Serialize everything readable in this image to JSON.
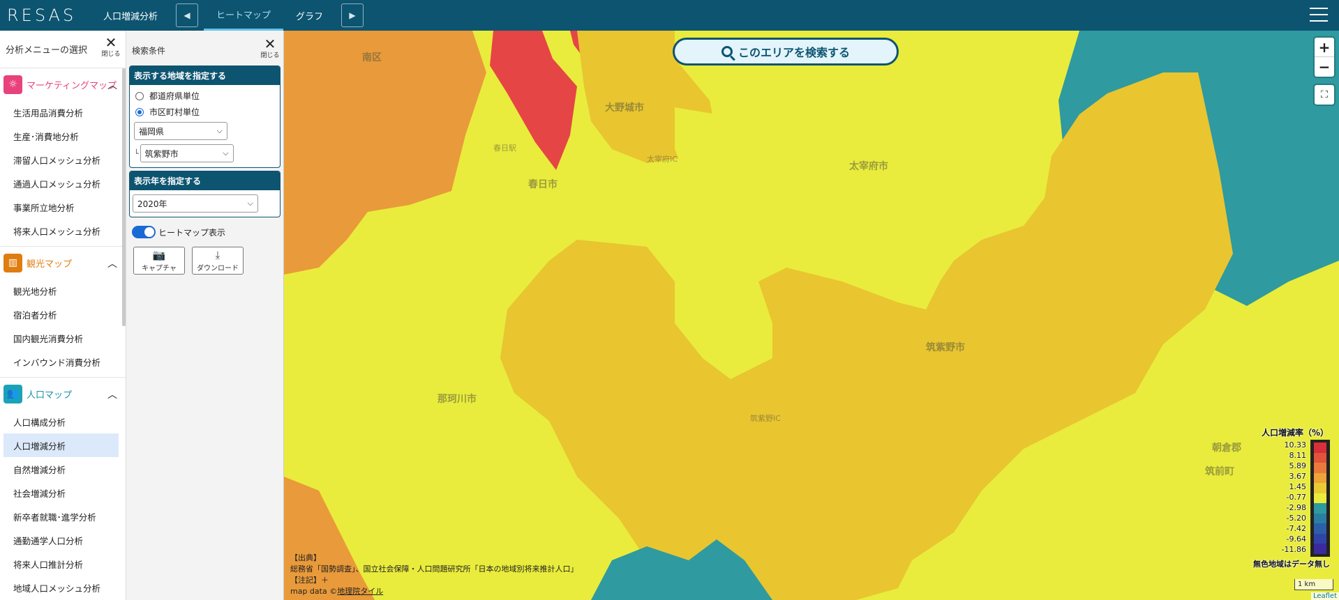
{
  "header": {
    "logo": "RESAS",
    "current_analysis": "人口増減分析",
    "tabs": [
      "ヒートマップ",
      "グラフ"
    ],
    "active_tab": "ヒートマップ",
    "prev_icon": "triangle-left-icon",
    "next_icon": "triangle-right-icon",
    "menu_icon": "hamburger-icon"
  },
  "left_menu": {
    "title": "分析メニューの選択",
    "close_label": "閉じる",
    "sections": [
      {
        "title": "マーケティングマップ",
        "icon": "lightbulb-icon",
        "color": "#e8427c",
        "items": [
          "生活用品消費分析",
          "生産･消費地分析",
          "滞留人口メッシュ分析",
          "通過人口メッシュ分析",
          "事業所立地分析",
          "将来人口メッシュ分析"
        ]
      },
      {
        "title": "観光マップ",
        "icon": "map-icon",
        "color": "#e07d10",
        "items": [
          "観光地分析",
          "宿泊者分析",
          "国内観光消費分析",
          "インバウンド消費分析"
        ]
      },
      {
        "title": "人口マップ",
        "icon": "people-icon",
        "color": "#1aa3b8",
        "items": [
          "人口構成分析",
          "人口増減分析",
          "自然増減分析",
          "社会増減分析",
          "新卒者就職･進学分析",
          "通勤通学人口分析",
          "将来人口推計分析",
          "地域人口メッシュ分析"
        ]
      }
    ],
    "active_item": "人口増減分析"
  },
  "search_panel": {
    "title": "検索条件",
    "close_label": "閉じる",
    "region_box_title": "表示する地域を指定する",
    "radio_options": [
      "都道府県単位",
      "市区町村単位"
    ],
    "radio_selected": "市区町村単位",
    "prefecture": "福岡県",
    "city_prefix": "└",
    "city": "筑紫野市",
    "year_box_title": "表示年を指定する",
    "year": "2020年",
    "heatmap_toggle_label": "ヒートマップ表示",
    "heatmap_on": true,
    "capture_label": "キャプチャ",
    "download_label": "ダウンロード"
  },
  "map": {
    "search_area_label": "このエリアを検索する",
    "zoom_in": "+",
    "zoom_out": "−",
    "fullscreen_icon": "fullscreen-icon",
    "place_labels": {
      "minami_ku": "南区",
      "onojo": "大野城市",
      "kasuga": "春日市",
      "dazaifu": "太宰府市",
      "chikushino": "筑紫野市",
      "nakagawa": "那珂川市",
      "asakura": "朝倉郡",
      "chikuzen": "筑前町",
      "dazaifu_ic": "太宰府IC",
      "kasuga_st": "春日駅",
      "chikushino_ic": "筑紫野IC"
    },
    "legend": {
      "title": "人口増減率（%）",
      "values": [
        "10.33",
        "8.11",
        "5.89",
        "3.67",
        "1.45",
        "-0.77",
        "-2.98",
        "-5.20",
        "-7.42",
        "-9.64",
        "-11.86"
      ],
      "colors": [
        "#d7303b",
        "#e0543c",
        "#ea7a3c",
        "#eda43a",
        "#e9ca33",
        "#e9ec3c",
        "#2f9aa0",
        "#2a7fa0",
        "#2d5ea8",
        "#3044a8",
        "#3a2a9e"
      ],
      "note": "無色地域はデータ無し"
    },
    "source": {
      "heading": "【出典】",
      "line": "総務省「国勢調査」、国立社会保障・人口問題研究所「日本の地域別将来推計人口」",
      "notes": "【注記】＋",
      "mapdata_prefix": "map data ©",
      "mapdata_link": "地理院タイル"
    },
    "scale_label": "1 km",
    "attribution": "Leaflet",
    "region_colors": {
      "yellow": "#e9ec3c",
      "orange": "#e9c530",
      "dark_orange": "#e99a3a",
      "red": "#e64545",
      "teal": "#2f9aa0"
    }
  }
}
